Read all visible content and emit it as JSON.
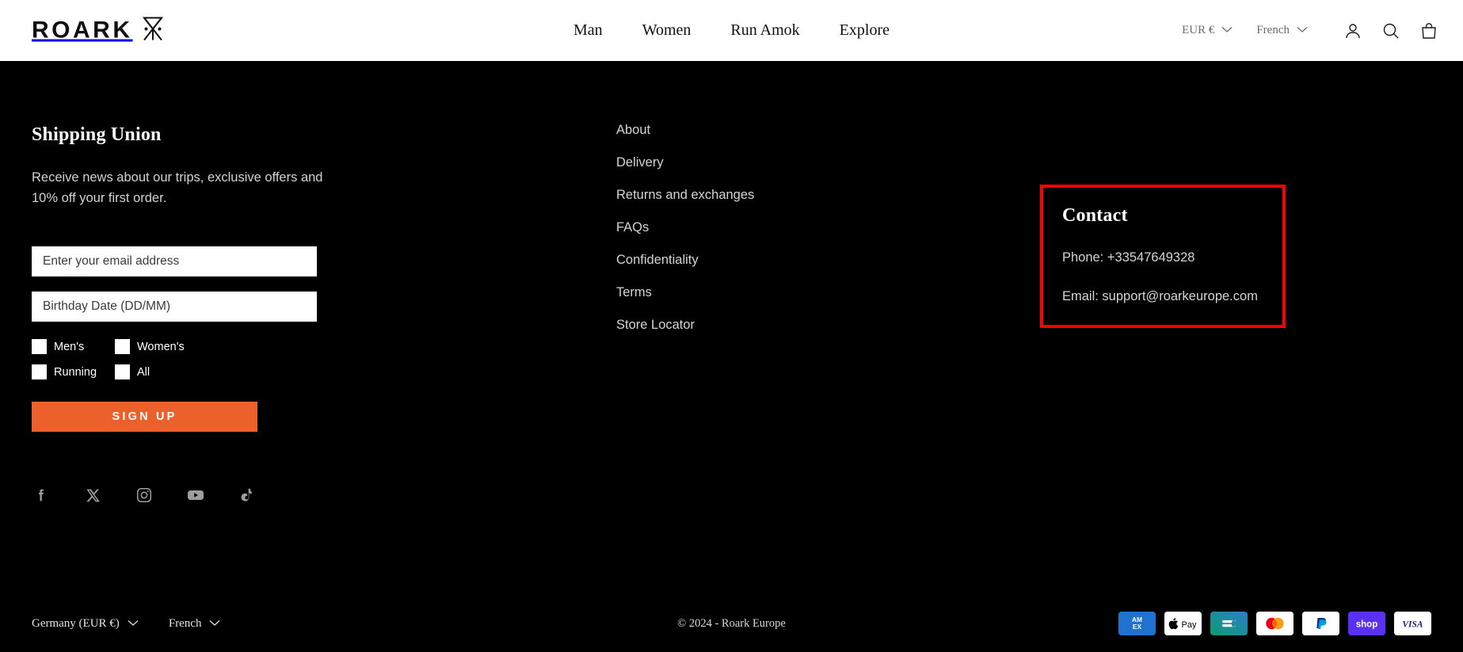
{
  "header": {
    "logo_text": "ROARK",
    "logo_mark": "roark-x-mark",
    "nav": [
      {
        "label": "Man"
      },
      {
        "label": "Women"
      },
      {
        "label": "Run Amok"
      },
      {
        "label": "Explore"
      }
    ],
    "currency_selector": {
      "label": "EUR €",
      "icon": "chevron-down-icon"
    },
    "language_selector": {
      "label": "French",
      "icon": "chevron-down-icon"
    },
    "icons": [
      {
        "name": "account-icon"
      },
      {
        "name": "search-icon"
      },
      {
        "name": "shopping-bag-icon"
      }
    ]
  },
  "footer": {
    "signup": {
      "title": "Shipping Union",
      "description": "Receive news about our trips, exclusive offers and 10% off your first order.",
      "email_placeholder": "Enter your email address",
      "email_value": "",
      "birthday_placeholder": "Birthday Date (DD/MM)",
      "birthday_value": "",
      "checkboxes": [
        {
          "label": "Men's",
          "checked": false
        },
        {
          "label": "Women's",
          "checked": false
        },
        {
          "label": "Running",
          "checked": false
        },
        {
          "label": "All",
          "checked": false
        }
      ],
      "button_label": "SIGN UP",
      "button_color": "#ec602c"
    },
    "socials": [
      {
        "name": "facebook-icon"
      },
      {
        "name": "x-twitter-icon"
      },
      {
        "name": "instagram-icon"
      },
      {
        "name": "youtube-icon"
      },
      {
        "name": "tiktok-icon"
      }
    ],
    "links": [
      {
        "label": "About"
      },
      {
        "label": "Delivery"
      },
      {
        "label": "Returns and exchanges"
      },
      {
        "label": "FAQs"
      },
      {
        "label": "Confidentiality"
      },
      {
        "label": "Terms"
      },
      {
        "label": "Store Locator"
      }
    ],
    "contact": {
      "title": "Contact",
      "phone": "Phone: +33547649328",
      "email": "Email: support@roarkeurope.com",
      "highlight_color": "#ff0000"
    },
    "bottom": {
      "country_selector": {
        "label": "Germany (EUR €)",
        "icon": "chevron-down-icon"
      },
      "language_selector": {
        "label": "French",
        "icon": "chevron-down-icon"
      },
      "copyright": "© 2024 - Roark Europe",
      "payments": [
        {
          "name": "amex-icon",
          "label": "AMEX"
        },
        {
          "name": "apple-pay-icon",
          "label": "Pay"
        },
        {
          "name": "cartes-bancaires-icon",
          "label": "CB"
        },
        {
          "name": "mastercard-icon",
          "label": "Mastercard"
        },
        {
          "name": "paypal-icon",
          "label": "PayPal"
        },
        {
          "name": "shop-pay-icon",
          "label": "shop"
        },
        {
          "name": "visa-icon",
          "label": "VISA"
        }
      ]
    }
  }
}
